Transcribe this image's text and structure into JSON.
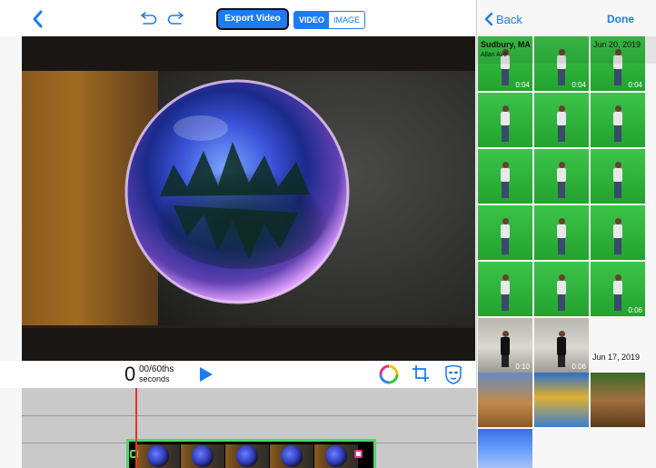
{
  "toolbar": {
    "export_label": "Export Video",
    "mode_video": "VIDEO",
    "mode_image": "IMAGE",
    "active_mode": "VIDEO"
  },
  "playback": {
    "time_whole": "0",
    "time_fraction": "00/60ths",
    "time_unit": "seconds"
  },
  "picker": {
    "back_label": "Back",
    "done_label": "Done",
    "groups": [
      {
        "location": "Sudbury, MA",
        "sublocation": "Allan Ave",
        "date": "Jun 20, 2019",
        "tiles": [
          {
            "kind": "green",
            "duration": "0:04"
          },
          {
            "kind": "green",
            "duration": "0:04"
          },
          {
            "kind": "green",
            "duration": "0:04"
          },
          {
            "kind": "green",
            "duration": ""
          },
          {
            "kind": "green",
            "duration": ""
          },
          {
            "kind": "green",
            "duration": ""
          },
          {
            "kind": "green",
            "duration": ""
          },
          {
            "kind": "green",
            "duration": ""
          },
          {
            "kind": "green",
            "duration": ""
          },
          {
            "kind": "green",
            "duration": ""
          },
          {
            "kind": "green",
            "duration": ""
          },
          {
            "kind": "green",
            "duration": ""
          },
          {
            "kind": "green",
            "duration": ""
          },
          {
            "kind": "green",
            "duration": ""
          },
          {
            "kind": "green",
            "duration": "0:06"
          },
          {
            "kind": "dark",
            "duration": "0:10"
          },
          {
            "kind": "dark",
            "duration": "0:06"
          }
        ]
      },
      {
        "date": "Jun 17, 2019",
        "tiles": [
          {
            "kind": "scene1",
            "duration": ""
          },
          {
            "kind": "scene2",
            "duration": ""
          },
          {
            "kind": "scene3",
            "duration": ""
          },
          {
            "kind": "scene4",
            "duration": ""
          }
        ]
      }
    ]
  },
  "colors": {
    "accent": "#1e7cf2",
    "playhead": "#e0342a",
    "clip_border": "#4cd964",
    "end_handle": "#e0348a"
  },
  "icons": [
    "back-chevron-icon",
    "undo-icon",
    "redo-icon",
    "play-icon",
    "color-wheel-icon",
    "crop-icon",
    "mask-icon"
  ]
}
